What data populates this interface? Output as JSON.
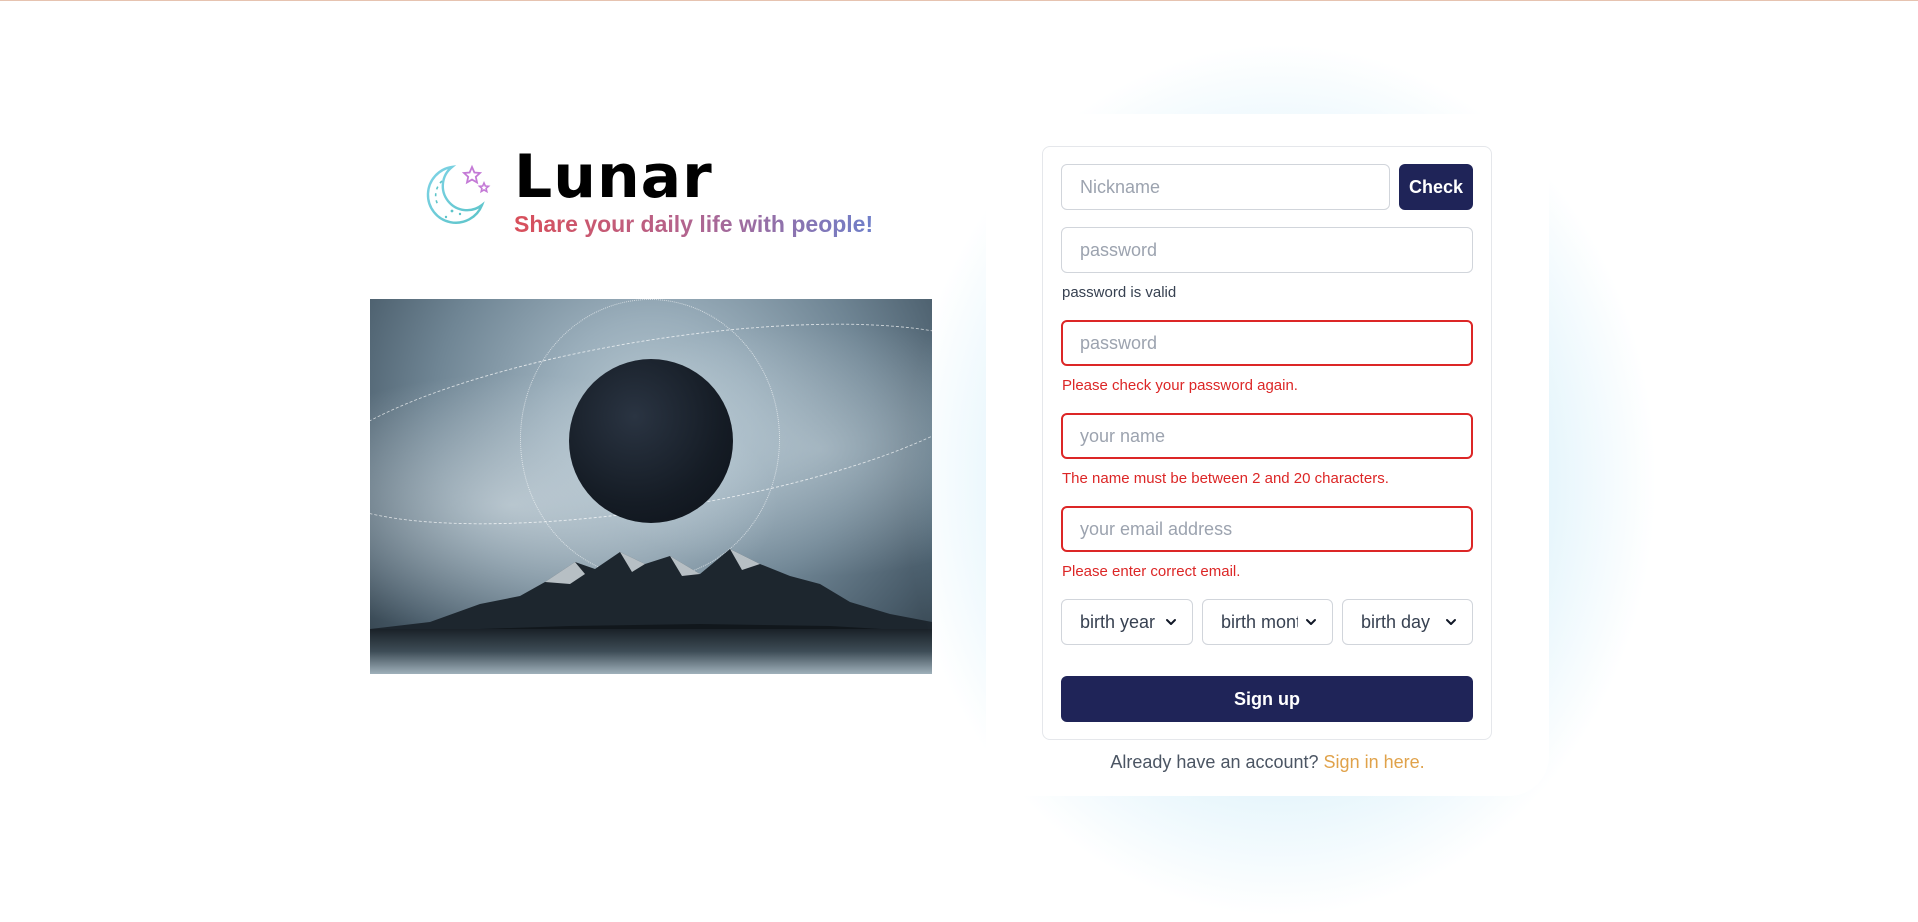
{
  "brand": {
    "title": "Lunar",
    "tagline": "Share your daily life with people!",
    "logo_icon": "moon-stars-icon"
  },
  "hero": {
    "image_icon": "eclipse-mountains-image"
  },
  "form": {
    "nickname": {
      "placeholder": "Nickname",
      "value": ""
    },
    "check_button": "Check",
    "password": {
      "placeholder": "password",
      "value": ""
    },
    "password_status": "password is valid",
    "password_confirm": {
      "placeholder": "password",
      "value": ""
    },
    "password_confirm_error": "Please check your password again.",
    "name": {
      "placeholder": "your name",
      "value": ""
    },
    "name_error": "The name must be between 2 and 20 characters.",
    "email": {
      "placeholder": "your email address",
      "value": ""
    },
    "email_error": "Please enter correct email.",
    "birth_year": "birth year",
    "birth_month": "birth month",
    "birth_day": "birth day",
    "submit_button": "Sign up"
  },
  "footer": {
    "prompt": "Already have an account?",
    "link": "Sign in here."
  },
  "colors": {
    "primary_button": "#1f2458",
    "error": "#dc2626",
    "link": "#e0a24a",
    "glow": "#82d2f0"
  }
}
